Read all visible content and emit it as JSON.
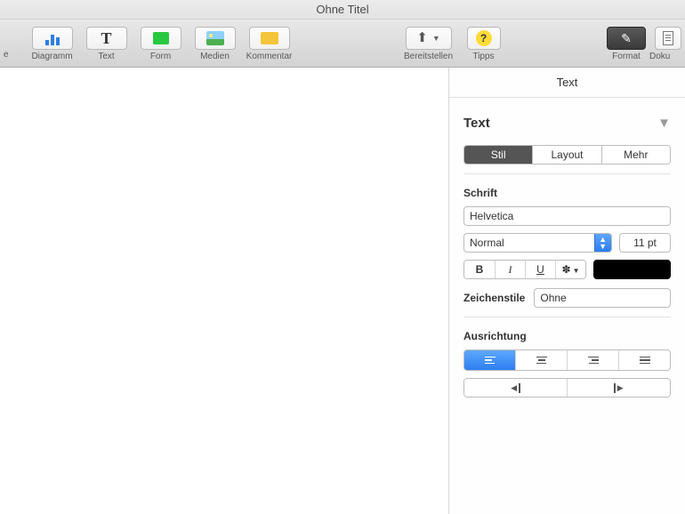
{
  "window": {
    "title": "Ohne Titel"
  },
  "toolbar": {
    "items_prev": {
      "label": "e"
    },
    "items": [
      {
        "id": "chart",
        "label": "Diagramm"
      },
      {
        "id": "text",
        "label": "Text",
        "glyph": "T"
      },
      {
        "id": "shape",
        "label": "Form"
      },
      {
        "id": "media",
        "label": "Medien"
      },
      {
        "id": "comment",
        "label": "Kommentar"
      }
    ],
    "share": {
      "label": "Bereitstellen"
    },
    "tips": {
      "label": "Tipps",
      "glyph": "?"
    },
    "format": {
      "label": "Format"
    },
    "document": {
      "label": "Doku"
    }
  },
  "inspector": {
    "tab": "Text",
    "paragraph_style": "Text",
    "subtabs": {
      "stil": "Stil",
      "layout": "Layout",
      "mehr": "Mehr",
      "active": 0
    },
    "font": {
      "section_label": "Schrift",
      "family": "Helvetica",
      "weight": "Normal",
      "size": "11 pt",
      "bold": "B",
      "italic": "I",
      "underline": "U",
      "gear": "✱▾",
      "color": "#000000"
    },
    "char_style": {
      "label": "Zeichenstile",
      "value": "Ohne"
    },
    "alignment": {
      "section_label": "Ausrichtung",
      "active": 0
    }
  }
}
